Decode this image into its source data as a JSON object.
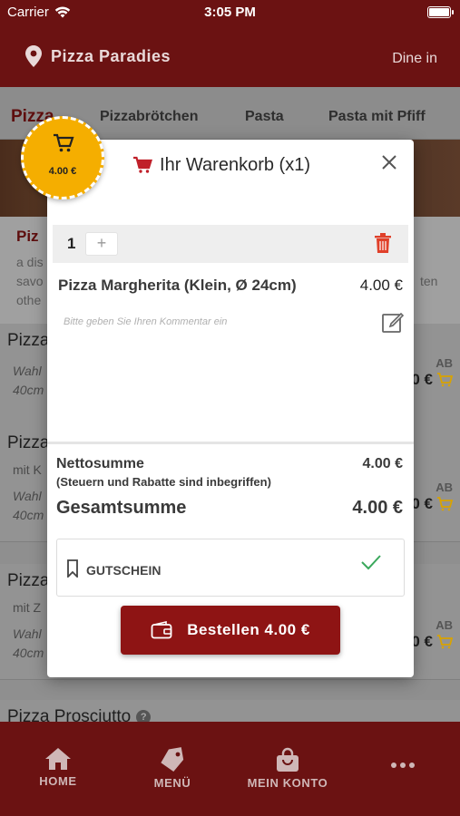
{
  "status_bar": {
    "carrier": "Carrier",
    "time": "3:05 PM"
  },
  "header": {
    "store_name": "Pizza Paradies",
    "mode": "Dine in"
  },
  "tabs": [
    {
      "label": "Pizza"
    },
    {
      "label": "Pizzabrötchen"
    },
    {
      "label": "Pasta"
    },
    {
      "label": "Pasta mit Pfiff"
    }
  ],
  "background": {
    "category_title": "Piz",
    "category_desc_lines": [
      "a dis",
      "savo",
      "othe"
    ],
    "category_desc_cut": "ten",
    "items": [
      {
        "name": "Pizza",
        "desc_lines": [
          "Wahl",
          "40cm"
        ],
        "ab": "AB",
        "price": "0 €"
      },
      {
        "name": "Pizza",
        "desc_lines": [
          "mit K",
          "Wahl",
          "40cm"
        ],
        "ab": "AB",
        "price": "0 €"
      },
      {
        "name": "Pizza",
        "desc_lines": [
          "mit Z",
          "Wahl",
          "40cm"
        ],
        "ab": "AB",
        "price": "0 €"
      },
      {
        "name": "Pizza Prosciutto",
        "desc_lines": [],
        "ab": "",
        "price": ""
      }
    ]
  },
  "cart_badge": {
    "total": "4.00 €"
  },
  "cart_modal": {
    "title": "Ihr Warenkorb (x1)",
    "quantity": "1",
    "plus": "+",
    "product_name": "Pizza Margherita (Klein, Ø 24cm)",
    "product_price": "4.00 €",
    "comment_placeholder": "Bitte geben Sie Ihren Kommentar ein",
    "net_label": "Nettosumme",
    "net_note": "(Steuern und Rabatte sind inbegriffen)",
    "net_value": "4.00 €",
    "total_label": "Gesamtsumme",
    "total_value": "4.00 €",
    "voucher_label": "GUTSCHEIN",
    "order_button": "Bestellen 4.00 €"
  },
  "bottom_nav": [
    {
      "label": "HOME",
      "icon": "home-icon"
    },
    {
      "label": "MENÜ",
      "icon": "tag-icon"
    },
    {
      "label": "MEIN KONTO",
      "icon": "bag-icon"
    },
    {
      "label": "",
      "icon": "more-icon"
    }
  ],
  "colors": {
    "brand": "#6b1212",
    "button": "#8e1414",
    "badge": "#f5ae00",
    "trash": "#e0402a",
    "check": "#3aa85c"
  }
}
